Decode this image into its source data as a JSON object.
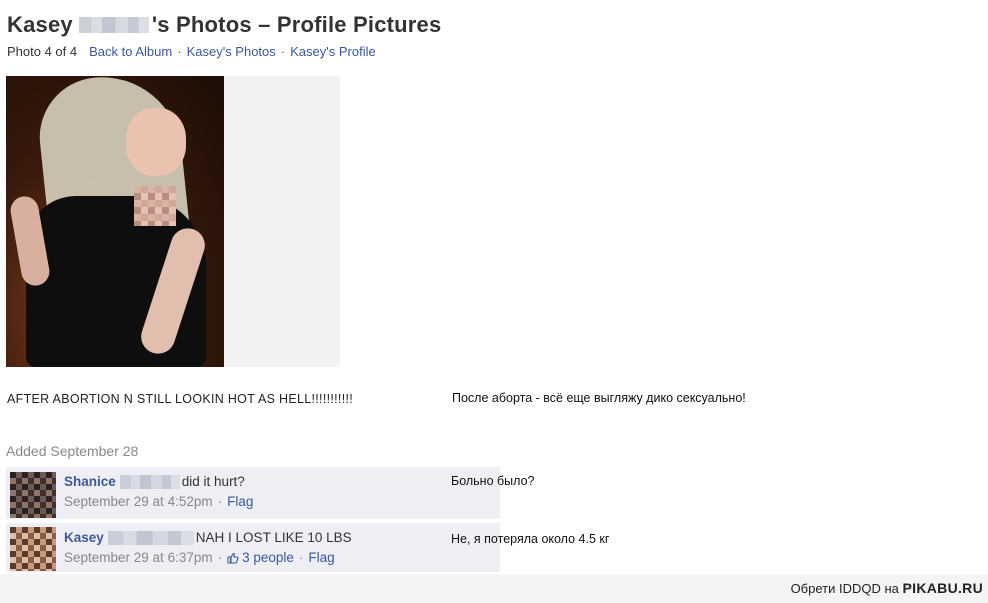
{
  "header": {
    "name_first": "Kasey",
    "title_suffix": "'s Photos – Profile Pictures"
  },
  "nav": {
    "photo_count": "Photo 4 of 4",
    "links": [
      "Back to Album",
      "Kasey's Photos",
      "Kasey's Profile"
    ],
    "separator": "·"
  },
  "photo": {
    "caption": "AFTER ABORTION N STILL LOOKIN HOT AS HELL!!!!!!!!!!!",
    "caption_translation": "После аборта - всё еще выгляжу дико сексуально!",
    "added": "Added September 28"
  },
  "comments": [
    {
      "name": "Shanice",
      "text": "did it hurt?",
      "time": "September 29 at 4:52pm",
      "likes": "",
      "flag": "Flag",
      "translation": "Больно было?"
    },
    {
      "name": "Kasey",
      "text": "NAH I LOST LIKE 10 LBS",
      "time": "September 29 at 6:37pm",
      "likes": "3 people",
      "flag": "Flag",
      "translation": "Не, я потеряла около 4.5 кг"
    }
  ],
  "footer": {
    "prefix": "Обрети IDDQD на",
    "brand": "PIKABU.RU"
  },
  "colors": {
    "link": "#3b5998",
    "comment_bg": "#edeff4",
    "muted": "#888888"
  }
}
